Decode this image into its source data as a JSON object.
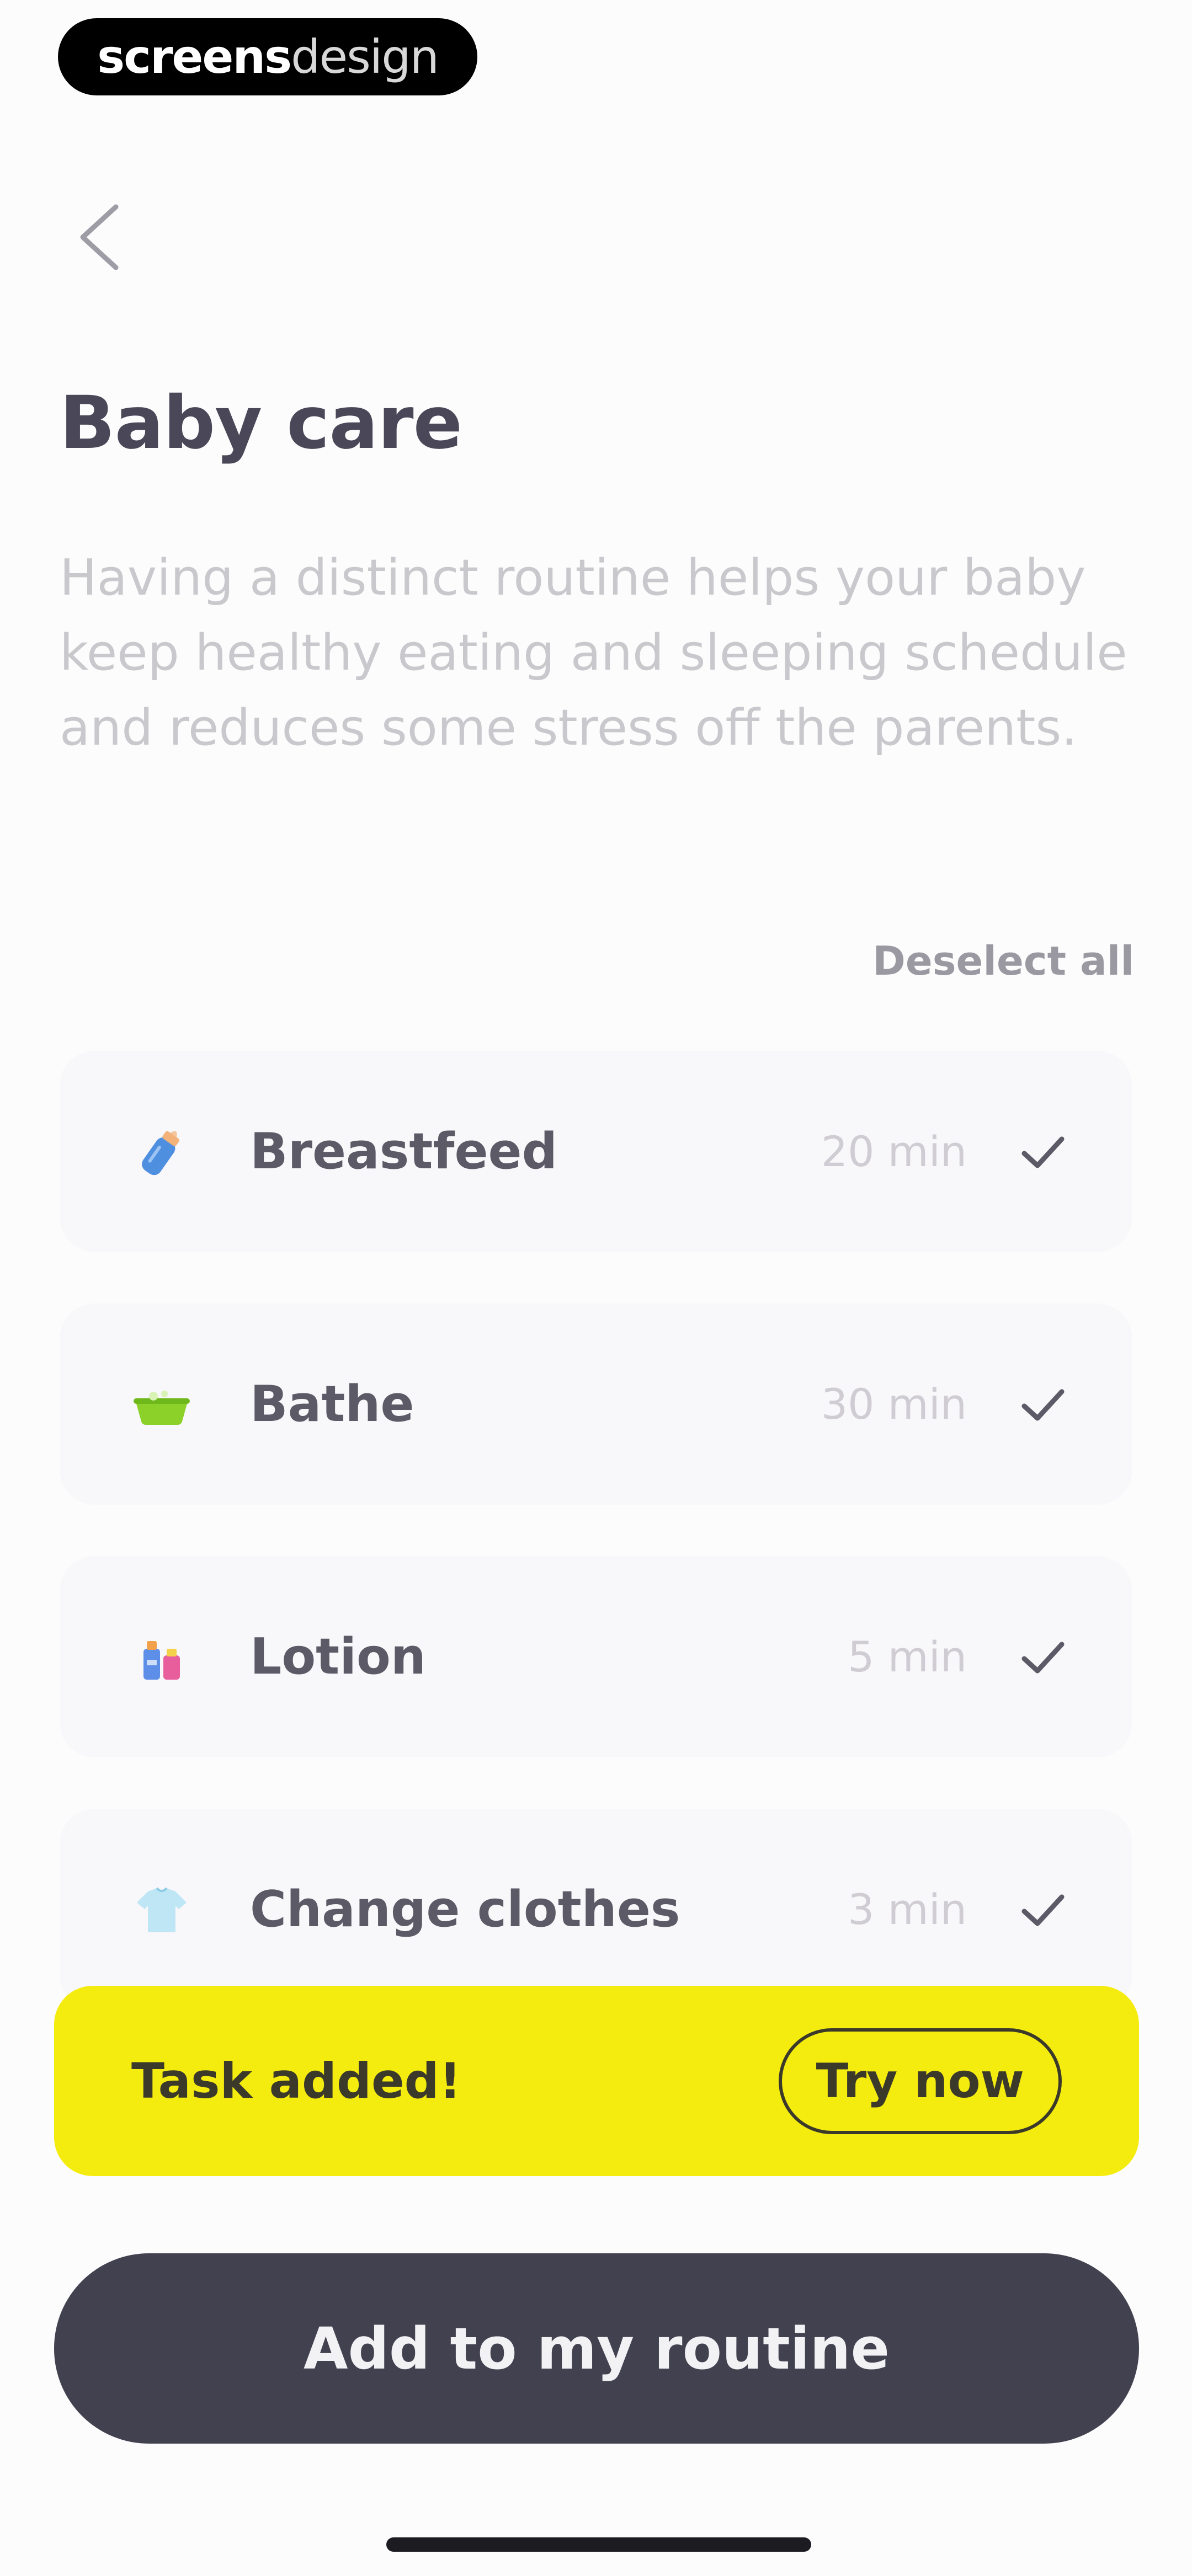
{
  "brand": {
    "part1": "screens",
    "part2": "design"
  },
  "header": {
    "title": "Baby care"
  },
  "description": "Having a distinct routine helps your baby keep healthy eating and sleeping schedule and reduces some stress off the parents.",
  "list_controls": {
    "deselect_label": "Deselect all"
  },
  "tasks": [
    {
      "name": "Breastfeed",
      "duration": "20 min",
      "icon": "bottle-icon",
      "selected": true
    },
    {
      "name": "Bathe",
      "duration": "30 min",
      "icon": "bathtub-icon",
      "selected": true
    },
    {
      "name": "Lotion",
      "duration": "5 min",
      "icon": "lotion-icon",
      "selected": true
    },
    {
      "name": "Change clothes",
      "duration": "3 min",
      "icon": "clothes-icon",
      "selected": true
    }
  ],
  "toast": {
    "message": "Task added!",
    "action": "Try now",
    "color": "#f5ec0f"
  },
  "cta": {
    "label": "Add to my routine",
    "color": "#42414f"
  }
}
